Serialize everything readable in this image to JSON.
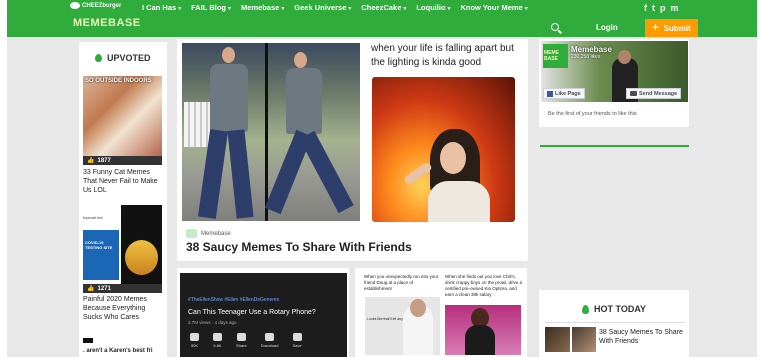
{
  "header": {
    "brand_small": "CHEEZburger",
    "site_logo": "MEMEBASE",
    "nav": [
      "I Can Has",
      "FAIL Blog",
      "Memebase",
      "Geek Universe",
      "CheezCake",
      "Loquilio",
      "Know Your Meme"
    ],
    "social": [
      "f",
      "t",
      "p",
      "m"
    ],
    "login": "Login",
    "submit": "Submit"
  },
  "sidebar_left": {
    "heading": "UPVOTED",
    "items": [
      {
        "thumb_text": "SO OUTSIDE INDOORS",
        "count": "1877",
        "title": "33 Funny Cat Memes That Never Fail to Make Us LOL"
      },
      {
        "thumb_top": "topsmall text",
        "thumb_tweet": "COVID-19 TESTING SITE",
        "count": "1271",
        "title": "Painful 2020 Memes Because Everything Sucks Who Cares"
      }
    ],
    "trailing_title": ". aren't a Karen's best fri"
  },
  "feature": {
    "caption": "when your life is falling apart but the lighting is kinda good",
    "source": "Memebase",
    "title": "38 Saucy Memes To Share With Friends"
  },
  "card_video": {
    "hashtags": "#TheEllenShow #Ellen #EllenDeGeneres",
    "title": "Can This Teenager Use a Rotary Phone?",
    "meta": "2.7M views · 4 days ago",
    "buttons": [
      "50K",
      "6.6K",
      "Share",
      "Download",
      "Save"
    ]
  },
  "card_text": {
    "left_text": "When you unexpectedly run into your friend Doug at a place of establishment",
    "left_sub": "Looks like that'll let anybody in here lol",
    "right_text": "When she finds out you love Chili's, drink crappy boys on the prowl, drive a certified pre-owned Kia Optima, and earn a clean 38k salary"
  },
  "facebook": {
    "logo": "MEME BASE",
    "name": "Memebase",
    "likes": "230,258 likes",
    "like_btn": "Like Page",
    "msg_btn": "Send Message",
    "friends": "Be the first of your friends to like this"
  },
  "hot_today": {
    "heading": "HOT TODAY",
    "item_title": "38 Saucy Memes To Share With Friends"
  }
}
